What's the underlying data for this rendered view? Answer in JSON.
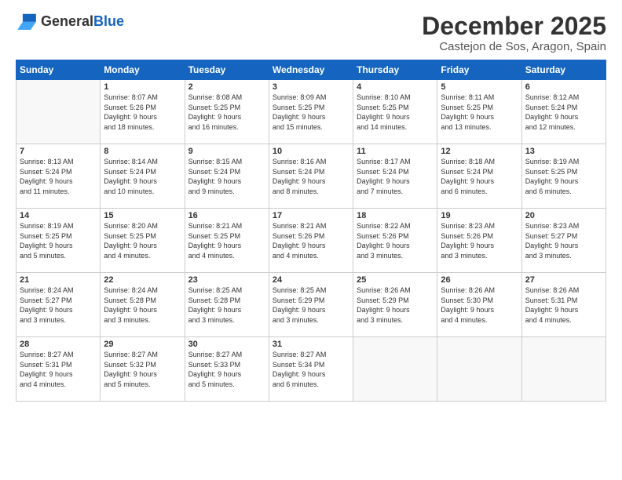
{
  "header": {
    "logo_general": "General",
    "logo_blue": "Blue",
    "month_title": "December 2025",
    "location": "Castejon de Sos, Aragon, Spain"
  },
  "days_of_week": [
    "Sunday",
    "Monday",
    "Tuesday",
    "Wednesday",
    "Thursday",
    "Friday",
    "Saturday"
  ],
  "weeks": [
    [
      {
        "day": "",
        "info": ""
      },
      {
        "day": "1",
        "info": "Sunrise: 8:07 AM\nSunset: 5:26 PM\nDaylight: 9 hours\nand 18 minutes."
      },
      {
        "day": "2",
        "info": "Sunrise: 8:08 AM\nSunset: 5:25 PM\nDaylight: 9 hours\nand 16 minutes."
      },
      {
        "day": "3",
        "info": "Sunrise: 8:09 AM\nSunset: 5:25 PM\nDaylight: 9 hours\nand 15 minutes."
      },
      {
        "day": "4",
        "info": "Sunrise: 8:10 AM\nSunset: 5:25 PM\nDaylight: 9 hours\nand 14 minutes."
      },
      {
        "day": "5",
        "info": "Sunrise: 8:11 AM\nSunset: 5:25 PM\nDaylight: 9 hours\nand 13 minutes."
      },
      {
        "day": "6",
        "info": "Sunrise: 8:12 AM\nSunset: 5:24 PM\nDaylight: 9 hours\nand 12 minutes."
      }
    ],
    [
      {
        "day": "7",
        "info": "Sunrise: 8:13 AM\nSunset: 5:24 PM\nDaylight: 9 hours\nand 11 minutes."
      },
      {
        "day": "8",
        "info": "Sunrise: 8:14 AM\nSunset: 5:24 PM\nDaylight: 9 hours\nand 10 minutes."
      },
      {
        "day": "9",
        "info": "Sunrise: 8:15 AM\nSunset: 5:24 PM\nDaylight: 9 hours\nand 9 minutes."
      },
      {
        "day": "10",
        "info": "Sunrise: 8:16 AM\nSunset: 5:24 PM\nDaylight: 9 hours\nand 8 minutes."
      },
      {
        "day": "11",
        "info": "Sunrise: 8:17 AM\nSunset: 5:24 PM\nDaylight: 9 hours\nand 7 minutes."
      },
      {
        "day": "12",
        "info": "Sunrise: 8:18 AM\nSunset: 5:24 PM\nDaylight: 9 hours\nand 6 minutes."
      },
      {
        "day": "13",
        "info": "Sunrise: 8:19 AM\nSunset: 5:25 PM\nDaylight: 9 hours\nand 6 minutes."
      }
    ],
    [
      {
        "day": "14",
        "info": "Sunrise: 8:19 AM\nSunset: 5:25 PM\nDaylight: 9 hours\nand 5 minutes."
      },
      {
        "day": "15",
        "info": "Sunrise: 8:20 AM\nSunset: 5:25 PM\nDaylight: 9 hours\nand 4 minutes."
      },
      {
        "day": "16",
        "info": "Sunrise: 8:21 AM\nSunset: 5:25 PM\nDaylight: 9 hours\nand 4 minutes."
      },
      {
        "day": "17",
        "info": "Sunrise: 8:21 AM\nSunset: 5:26 PM\nDaylight: 9 hours\nand 4 minutes."
      },
      {
        "day": "18",
        "info": "Sunrise: 8:22 AM\nSunset: 5:26 PM\nDaylight: 9 hours\nand 3 minutes."
      },
      {
        "day": "19",
        "info": "Sunrise: 8:23 AM\nSunset: 5:26 PM\nDaylight: 9 hours\nand 3 minutes."
      },
      {
        "day": "20",
        "info": "Sunrise: 8:23 AM\nSunset: 5:27 PM\nDaylight: 9 hours\nand 3 minutes."
      }
    ],
    [
      {
        "day": "21",
        "info": "Sunrise: 8:24 AM\nSunset: 5:27 PM\nDaylight: 9 hours\nand 3 minutes."
      },
      {
        "day": "22",
        "info": "Sunrise: 8:24 AM\nSunset: 5:28 PM\nDaylight: 9 hours\nand 3 minutes."
      },
      {
        "day": "23",
        "info": "Sunrise: 8:25 AM\nSunset: 5:28 PM\nDaylight: 9 hours\nand 3 minutes."
      },
      {
        "day": "24",
        "info": "Sunrise: 8:25 AM\nSunset: 5:29 PM\nDaylight: 9 hours\nand 3 minutes."
      },
      {
        "day": "25",
        "info": "Sunrise: 8:26 AM\nSunset: 5:29 PM\nDaylight: 9 hours\nand 3 minutes."
      },
      {
        "day": "26",
        "info": "Sunrise: 8:26 AM\nSunset: 5:30 PM\nDaylight: 9 hours\nand 4 minutes."
      },
      {
        "day": "27",
        "info": "Sunrise: 8:26 AM\nSunset: 5:31 PM\nDaylight: 9 hours\nand 4 minutes."
      }
    ],
    [
      {
        "day": "28",
        "info": "Sunrise: 8:27 AM\nSunset: 5:31 PM\nDaylight: 9 hours\nand 4 minutes."
      },
      {
        "day": "29",
        "info": "Sunrise: 8:27 AM\nSunset: 5:32 PM\nDaylight: 9 hours\nand 5 minutes."
      },
      {
        "day": "30",
        "info": "Sunrise: 8:27 AM\nSunset: 5:33 PM\nDaylight: 9 hours\nand 5 minutes."
      },
      {
        "day": "31",
        "info": "Sunrise: 8:27 AM\nSunset: 5:34 PM\nDaylight: 9 hours\nand 6 minutes."
      },
      {
        "day": "",
        "info": ""
      },
      {
        "day": "",
        "info": ""
      },
      {
        "day": "",
        "info": ""
      }
    ]
  ]
}
